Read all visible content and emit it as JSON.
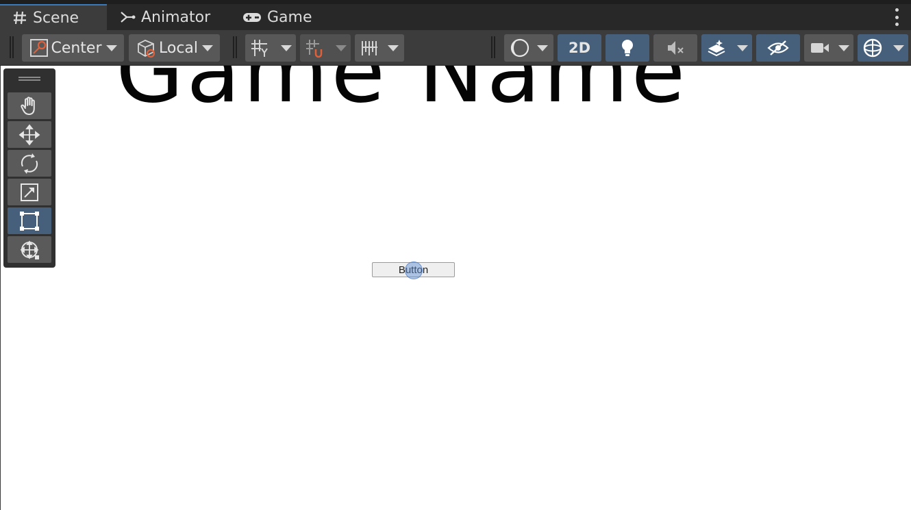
{
  "tabs": [
    {
      "label": "Scene",
      "icon": "hash-icon",
      "active": true
    },
    {
      "label": "Animator",
      "icon": "animator-icon",
      "active": false
    },
    {
      "label": "Game",
      "icon": "gamepad-icon",
      "active": false
    }
  ],
  "toolbar": {
    "pivot_label": "Center",
    "space_label": "Local",
    "mode_2d_label": "2D"
  },
  "scene": {
    "title_text": "Game Name",
    "button_label": "Button"
  },
  "tools": [
    {
      "name": "hand-tool",
      "icon": "hand-icon"
    },
    {
      "name": "move-tool",
      "icon": "move-arrows-icon"
    },
    {
      "name": "rotate-tool",
      "icon": "rotate-icon"
    },
    {
      "name": "scale-tool",
      "icon": "scale-icon"
    },
    {
      "name": "rect-tool",
      "icon": "rect-transform-icon",
      "active": true
    },
    {
      "name": "transform-tool",
      "icon": "transform-icon"
    }
  ],
  "colors": {
    "accent": "#46607c",
    "tab_highlight": "#3a79bb",
    "toolbar_bg": "#3c3c3c",
    "scene_bg": "#ffffff"
  }
}
